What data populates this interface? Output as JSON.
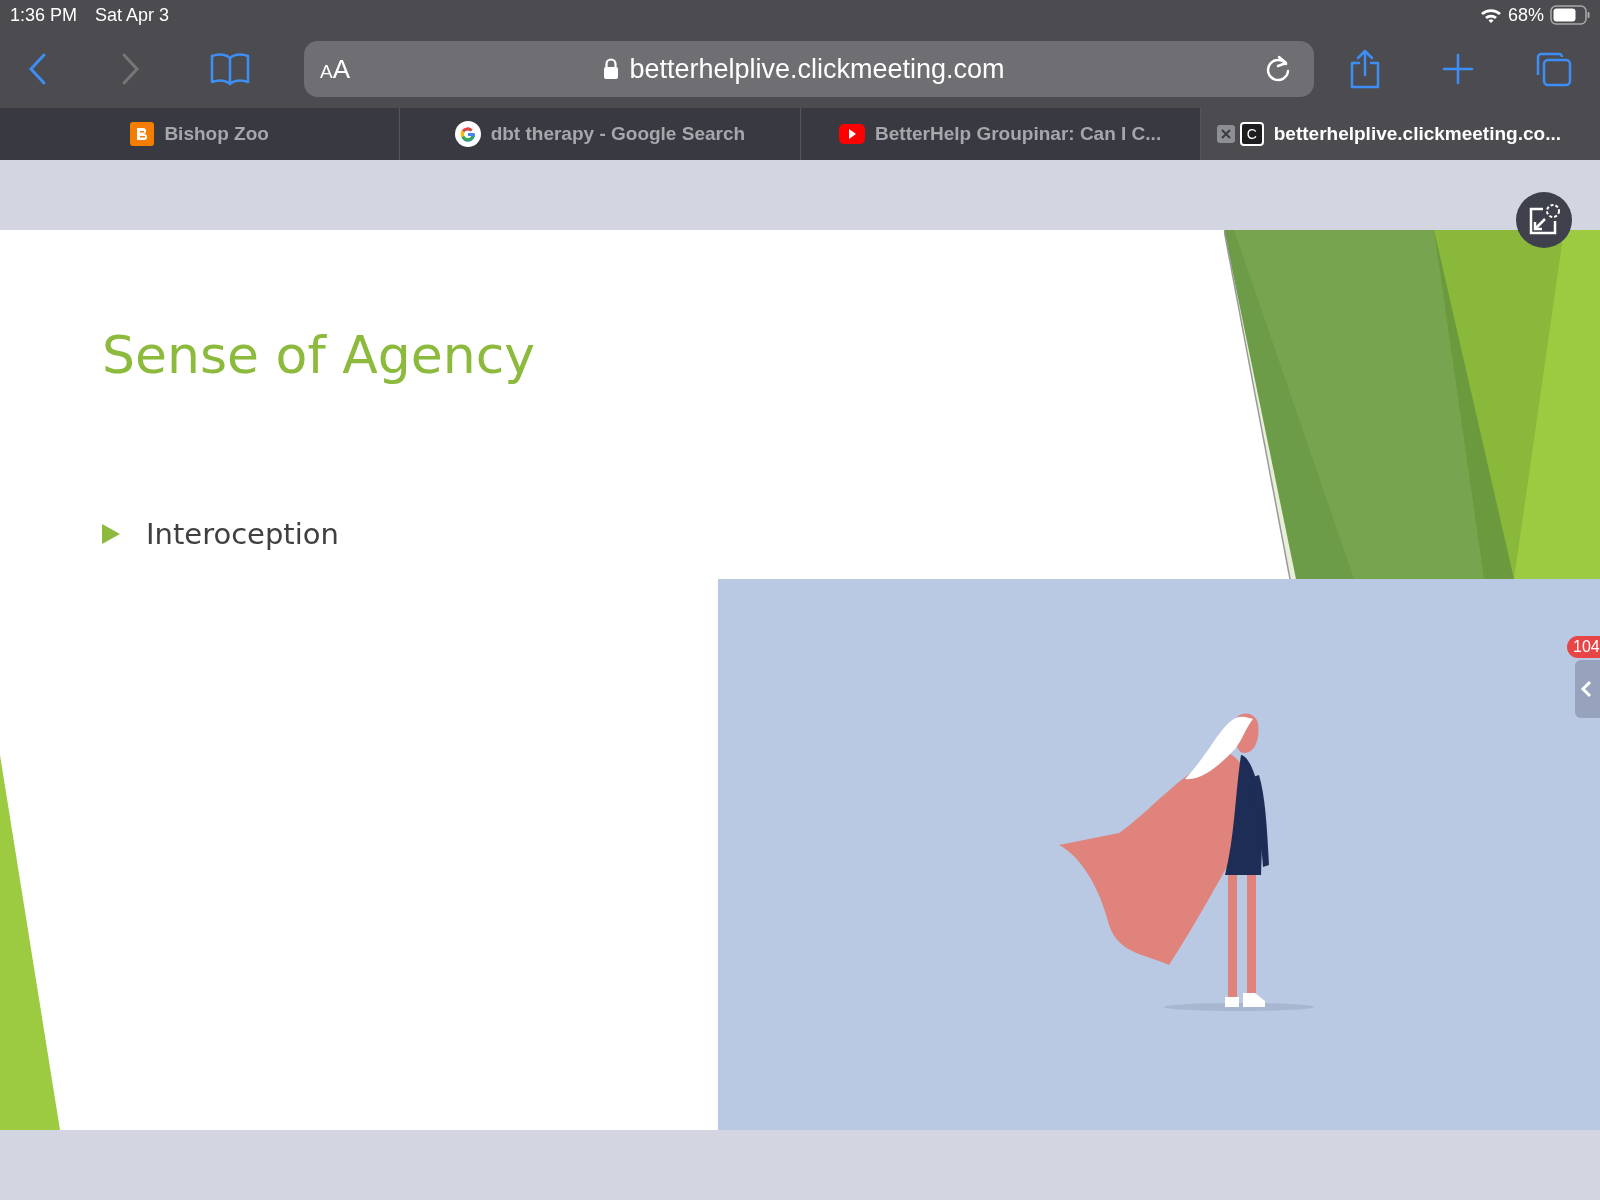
{
  "status_bar": {
    "time": "1:36 PM",
    "date": "Sat Apr 3",
    "battery": "68%"
  },
  "toolbar": {
    "back_disabled": false,
    "forward_disabled": true,
    "text_size": "AA",
    "url": "betterhelplive.clickmeeting.com"
  },
  "tabs": [
    {
      "title": "Bishop Zoo",
      "kind": "blogger",
      "selected": false
    },
    {
      "title": "dbt therapy - Google Search",
      "kind": "google",
      "selected": false
    },
    {
      "title": "BetterHelp Groupinar: Can I C...",
      "kind": "youtube",
      "selected": false
    },
    {
      "title": "betterhelplive.clickmeeting.co...",
      "kind": "letter",
      "icon_text": "C",
      "selected": true
    }
  ],
  "slide": {
    "title": "Sense of Agency",
    "bullets": [
      "Interoception"
    ]
  },
  "side_panel": {
    "badge": "104"
  }
}
